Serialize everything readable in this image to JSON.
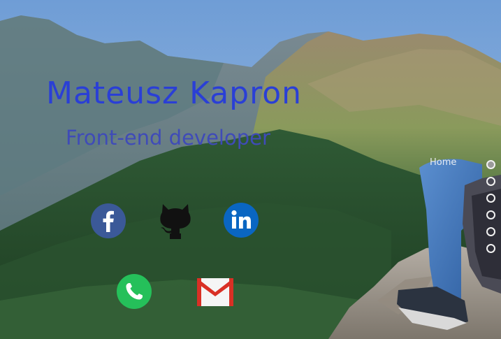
{
  "hero": {
    "name": "Mateusz Kapron",
    "role": "Front-end developer"
  },
  "nav": {
    "active_label": "Home",
    "dots": [
      {
        "state": "active"
      },
      {
        "state": "inactive"
      },
      {
        "state": "inactive"
      },
      {
        "state": "inactive"
      },
      {
        "state": "inactive"
      },
      {
        "state": "inactive"
      }
    ]
  },
  "social_links": [
    {
      "id": "facebook",
      "icon": "facebook-icon",
      "color": "#3b5998"
    },
    {
      "id": "github",
      "icon": "github-icon",
      "color": "#111111"
    },
    {
      "id": "linkedin",
      "icon": "linkedin-icon",
      "color": "#0a66c2"
    },
    {
      "id": "phone",
      "icon": "phone-icon",
      "color": "#25c05a"
    },
    {
      "id": "gmail",
      "icon": "gmail-icon",
      "color": "#d93025"
    }
  ],
  "colors": {
    "title": "#2a3fd6",
    "subtitle": "#3f4bb8"
  }
}
